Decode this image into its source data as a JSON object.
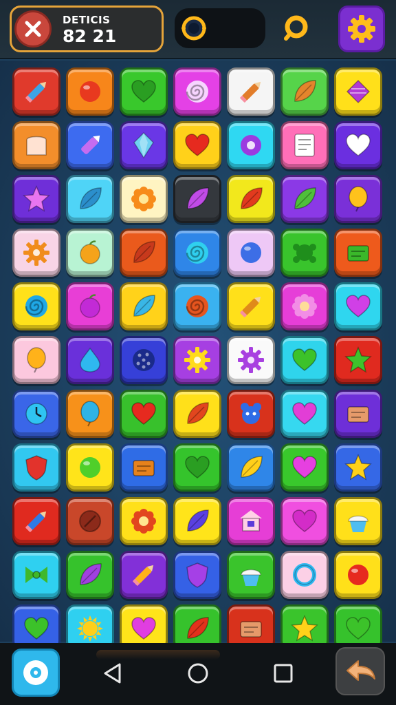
{
  "header": {
    "score_label": "DЕTICIS",
    "score_value": "82 21",
    "close_icon": "close-x-icon",
    "cog_icon": "cog-ring-icon",
    "search_icon": "search-ring-icon",
    "settings_icon": "gear-icon"
  },
  "board": {
    "columns": 7,
    "rows": 11,
    "tiles": [
      [
        "red",
        "pencil",
        "#e03a2c",
        "#3da3e6"
      ],
      [
        "orange",
        "ball",
        "#f7861a",
        "#e8391f"
      ],
      [
        "green",
        "heart",
        "#39c82c",
        "#2a9e22"
      ],
      [
        "magenta",
        "swirl",
        "#e441e6",
        "#f7d4ff"
      ],
      [
        "white",
        "pencil",
        "#f5f5f5",
        "#e27d2a"
      ],
      [
        "green",
        "leaf",
        "#56d44a",
        "#e4852c"
      ],
      [
        "yellow",
        "candy",
        "#ffe01a",
        "#b23bd4"
      ],
      [
        "orange",
        "bread",
        "#f38e2b",
        "#ffe2d2"
      ],
      [
        "blue",
        "crayon",
        "#3d6bf0",
        "#c56cf0"
      ],
      [
        "purple",
        "gem",
        "#6a37e6",
        "#6fd1f2"
      ],
      [
        "yellow",
        "heart",
        "#ffd11a",
        "#e62a1f"
      ],
      [
        "cyan",
        "donut",
        "#2fd8f2",
        "#9b3be0"
      ],
      [
        "pink",
        "note",
        "#ff6fb8",
        "#ffffff"
      ],
      [
        "purple",
        "heart",
        "#6b2fe0",
        "#ffffff"
      ],
      [
        "purple",
        "star",
        "#6f2fd8",
        "#e875f0"
      ],
      [
        "cyan",
        "leaf",
        "#4fd4f7",
        "#2b8fcc"
      ],
      [
        "cream",
        "flower",
        "#fff4c2",
        "#f78b1a"
      ],
      [
        "dark",
        "leaf",
        "#34383d",
        "#c04be6"
      ],
      [
        "yellow",
        "leaf",
        "#f2e81c",
        "#e23a1e"
      ],
      [
        "purple",
        "leaf",
        "#8b39e6",
        "#4fbf3a"
      ],
      [
        "purple",
        "balloon",
        "#7a30d8",
        "#ffc21c"
      ],
      [
        "pink",
        "gear",
        "#f8d4e6",
        "#f08c1c"
      ],
      [
        "mint",
        "apple",
        "#b8f3d3",
        "#f5a31a"
      ],
      [
        "orange",
        "leaf",
        "#ea5a1c",
        "#c7391c"
      ],
      [
        "blue",
        "swirl",
        "#2f86e8",
        "#2fd0ef"
      ],
      [
        "lavender",
        "ball",
        "#eec8f6",
        "#3d6ee6"
      ],
      [
        "green",
        "splat",
        "#39c42c",
        "#1f8e1c"
      ],
      [
        "orange",
        "box",
        "#ee5a1c",
        "#3ab82a"
      ],
      [
        "yellow",
        "swirl",
        "#ffe11a",
        "#1fa8e6"
      ],
      [
        "magenta",
        "apple",
        "#e83ed6",
        "#c22ad6"
      ],
      [
        "yellow",
        "leaf",
        "#ffd21a",
        "#39b6e6"
      ],
      [
        "blue",
        "swirl",
        "#3ab2f0",
        "#e6551e"
      ],
      [
        "yellow",
        "pencil",
        "#ffe01a",
        "#e08a1a"
      ],
      [
        "magenta",
        "flower",
        "#e63ed8",
        "#f28de6"
      ],
      [
        "cyan",
        "heart",
        "#2fd6ef",
        "#d040e6"
      ],
      [
        "pink",
        "balloon",
        "#fcc8de",
        "#ffb21a"
      ],
      [
        "purple",
        "drop",
        "#6a30da",
        "#2fb8ef"
      ],
      [
        "purple",
        "cookie",
        "#3640d8",
        "#1a2a8a"
      ],
      [
        "purple",
        "gear",
        "#a63fe2",
        "#ffdb1a"
      ],
      [
        "white",
        "gear",
        "#fafafa",
        "#a840e0"
      ],
      [
        "cyan",
        "heart",
        "#2fd4ec",
        "#3cc22a"
      ],
      [
        "red",
        "star",
        "#e02a1f",
        "#3fc22c"
      ],
      [
        "blue",
        "clock",
        "#3a66e8",
        "#2fc4f2"
      ],
      [
        "orange",
        "balloon",
        "#f7911a",
        "#2fb3e6"
      ],
      [
        "green",
        "heart",
        "#38c12c",
        "#e62a1f"
      ],
      [
        "yellow",
        "leaf",
        "#ffe01a",
        "#e2461e"
      ],
      [
        "red",
        "bear",
        "#d8321c",
        "#2f6ce6"
      ],
      [
        "cyan",
        "heart",
        "#36d8f0",
        "#e23ed6"
      ],
      [
        "purple",
        "box",
        "#6e2fd8",
        "#e69a6a"
      ],
      [
        "cyan",
        "shield",
        "#32c8f0",
        "#e2332c"
      ],
      [
        "yellow",
        "ball",
        "#ffe41a",
        "#4fcf2a"
      ],
      [
        "blue",
        "box",
        "#2f6ce6",
        "#e6821c"
      ],
      [
        "green",
        "heart",
        "#35c42c",
        "#2a9e22"
      ],
      [
        "blue",
        "leaf",
        "#2f86e8",
        "#ffcf1a"
      ],
      [
        "green",
        "heart",
        "#39c82c",
        "#e640e0"
      ],
      [
        "blue",
        "star",
        "#3568e6",
        "#ffd21a"
      ],
      [
        "red",
        "pencil",
        "#e02a1f",
        "#2f7ae6"
      ],
      [
        "orange",
        "coin",
        "#c9472a",
        "#8c2a1a"
      ],
      [
        "yellow",
        "flower",
        "#ffe01a",
        "#e2461e"
      ],
      [
        "yellow",
        "leaf",
        "#ffe41a",
        "#5a40e0"
      ],
      [
        "magenta",
        "house",
        "#e63ed6",
        "#ffd1e6"
      ],
      [
        "magenta",
        "heart",
        "#f04fe0",
        "#d32cc8"
      ],
      [
        "yellow",
        "cupcake",
        "#ffe01a",
        "#4fbdf0"
      ],
      [
        "cyan",
        "bow",
        "#2fd0f0",
        "#3fb82a"
      ],
      [
        "green",
        "leaf",
        "#36c22c",
        "#a040e0"
      ],
      [
        "purple",
        "pencil",
        "#8230d8",
        "#ffb21a"
      ],
      [
        "blue",
        "shield",
        "#3561e6",
        "#a540e6"
      ],
      [
        "green",
        "cupcake",
        "#3ac42c",
        "#4fbdf0"
      ],
      [
        "pink",
        "ring",
        "#fcd0e6",
        "#2fb8f0"
      ],
      [
        "yellow",
        "ball",
        "#ffe01a",
        "#e62a1f"
      ],
      [
        "blue",
        "heart",
        "#3561e6",
        "#3cc22a"
      ],
      [
        "cyan",
        "sun",
        "#2fd0f0",
        "#ffcf1a"
      ],
      [
        "yellow",
        "heart",
        "#ffe41a",
        "#e03ee0"
      ],
      [
        "green",
        "leaf",
        "#36c22c",
        "#e2311c"
      ],
      [
        "red",
        "box",
        "#d8321c",
        "#e69a6a"
      ],
      [
        "green",
        "star",
        "#3ac42c",
        "#ffd21a"
      ],
      [
        "green",
        "heart",
        "#36c22c",
        "#3cc22a"
      ]
    ]
  },
  "footer": {
    "home_icon": "home-circle-icon",
    "back_icon": "back-triangle-icon",
    "home_nav_icon": "home-circle-nav-icon",
    "recents_icon": "recents-square-icon",
    "undo_icon": "undo-arrow-icon"
  }
}
